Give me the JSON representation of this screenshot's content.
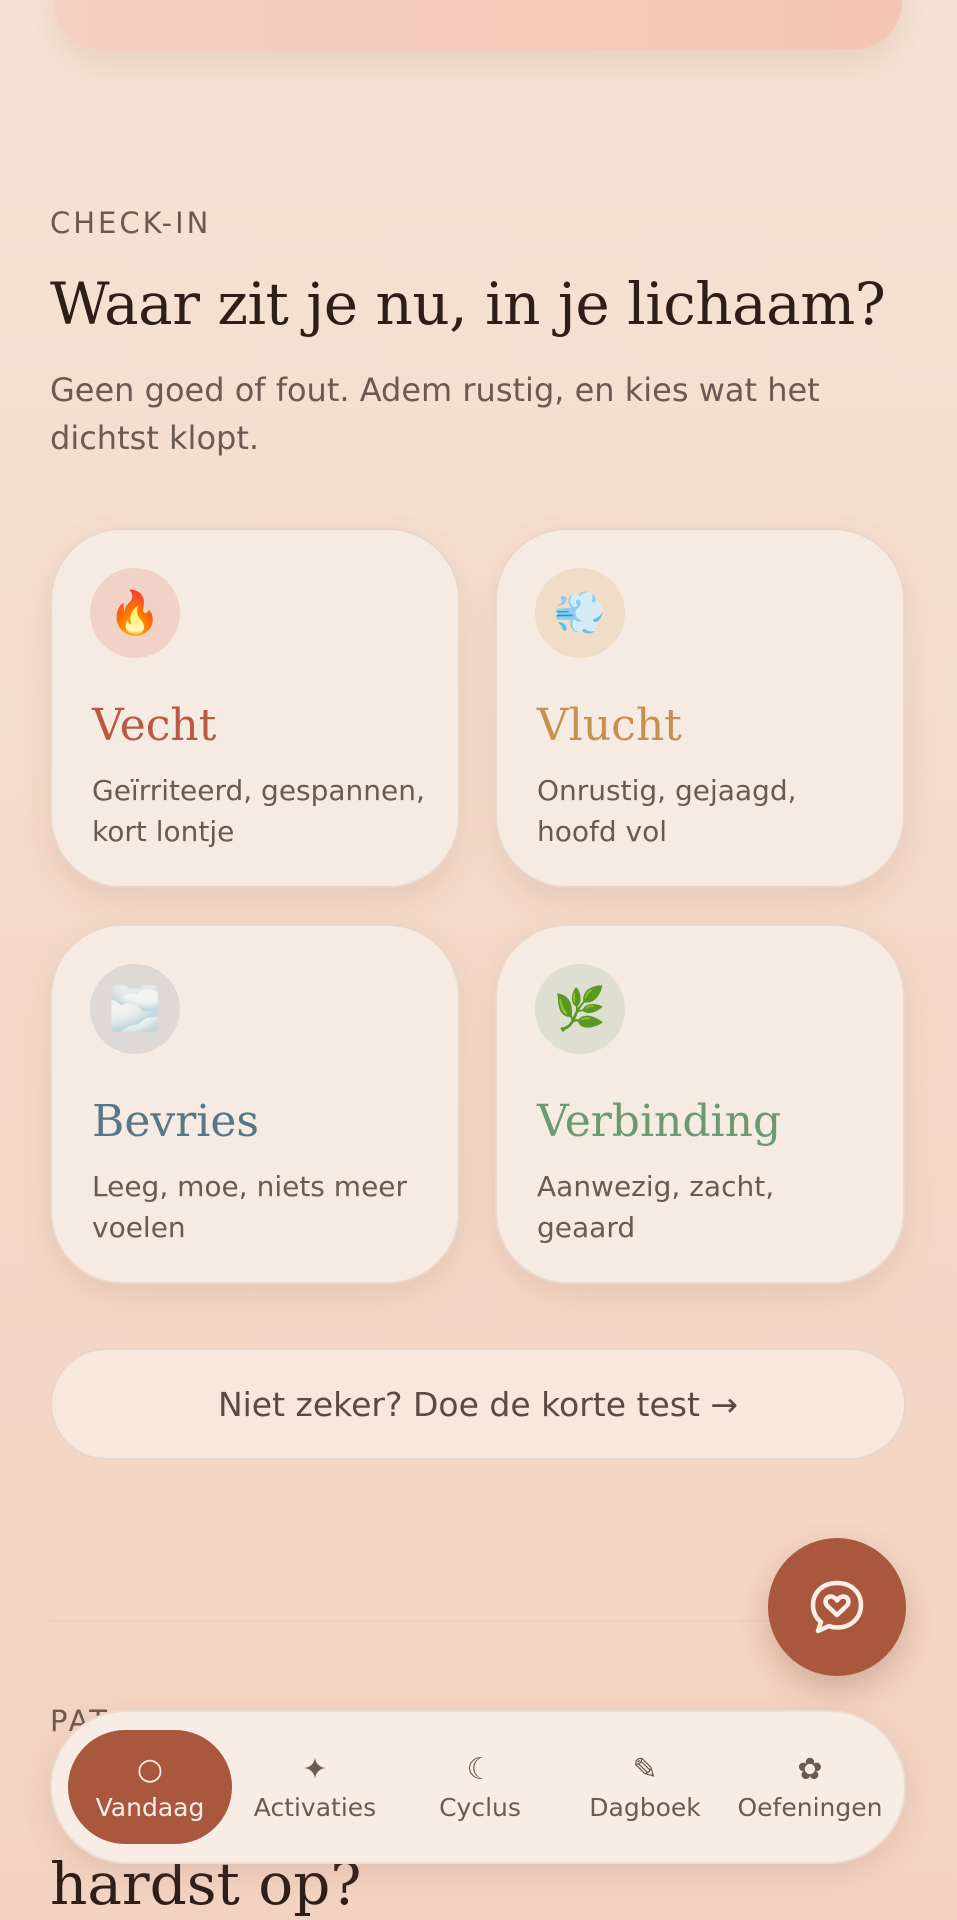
{
  "checkin": {
    "eyebrow": "CHECK-IN",
    "title": "Waar zit je nu, in je lichaam?",
    "subtitle": "Geen goed of fout. Adem rustig, en kies wat het dichtst klopt."
  },
  "states": [
    {
      "emoji": "🔥",
      "icon": "fire-icon",
      "title": "Vecht",
      "description": "Geïrriteerd, gespannen, kort lontje",
      "color": "#b85a42",
      "circle": "#f0d2c6"
    },
    {
      "emoji": "💨",
      "icon": "wind-icon",
      "title": "Vlucht",
      "description": "Onrustig, gejaagd, hoofd vol",
      "color": "#c7904e",
      "circle": "#f0dcc7"
    },
    {
      "emoji": "🌫️",
      "icon": "fog-icon",
      "title": "Bevries",
      "description": "Leeg, moe, niets meer voelen",
      "color": "#587689",
      "circle": "#dfd9d6"
    },
    {
      "emoji": "🌿",
      "icon": "leaf-icon",
      "title": "Verbinding",
      "description": "Aanwezig, zacht, geaard",
      "color": "#6b9a72",
      "circle": "#dedfd0"
    }
  ],
  "test_button": {
    "label": "Niet zeker? Doe de korte test →"
  },
  "next_section": {
    "eyebrow": "PAT",
    "title": "hardst op?"
  },
  "fab": {
    "icon": "heart-chat-icon"
  },
  "nav": {
    "items": [
      {
        "label": "Vandaag",
        "glyph": "○",
        "icon": "circle-icon",
        "active": true
      },
      {
        "label": "Activaties",
        "glyph": "✦",
        "icon": "sparkle-icon",
        "active": false
      },
      {
        "label": "Cyclus",
        "glyph": "☾",
        "icon": "moon-icon",
        "active": false
      },
      {
        "label": "Dagboek",
        "glyph": "✎",
        "icon": "pencil-icon",
        "active": false
      },
      {
        "label": "Oefeningen",
        "glyph": "✿",
        "icon": "flower-icon",
        "active": false
      }
    ]
  }
}
